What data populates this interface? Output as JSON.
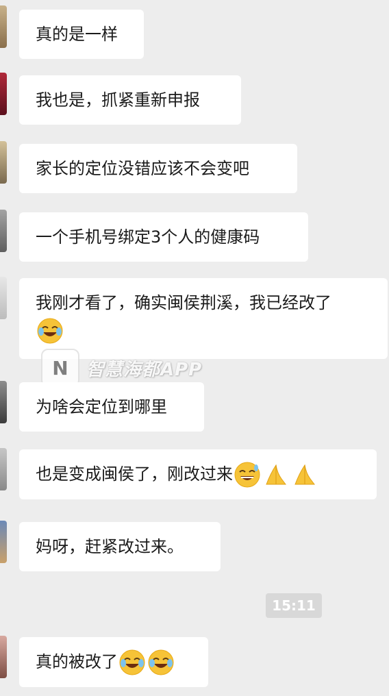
{
  "messages": [
    {
      "text": "真的是一样",
      "emojis": []
    },
    {
      "text": "我也是，抓紧重新申报",
      "emojis": []
    },
    {
      "text": "家长的定位没错应该不会变吧",
      "emojis": []
    },
    {
      "text": "一个手机号绑定3个人的健康码",
      "emojis": []
    },
    {
      "text": "我刚才看了，确实闽侯荆溪，我已经改了",
      "emojis": [
        "crying-laughing-emoji"
      ]
    },
    {
      "text": "为啥会定位到哪里",
      "emojis": []
    },
    {
      "text": "也是变成闽侯了，刚改过来",
      "emojis": [
        "grinning-sweat-emoji",
        "folded-hands-emoji",
        "folded-hands-emoji"
      ]
    },
    {
      "text": "妈呀，赶紧改过来。",
      "emojis": []
    },
    {
      "text": "真的被改了",
      "emojis": [
        "crying-laughing-emoji",
        "crying-laughing-emoji"
      ]
    }
  ],
  "timestamp": "15:11",
  "watermark": {
    "logo_text": "N",
    "text": "智慧海都APP"
  }
}
